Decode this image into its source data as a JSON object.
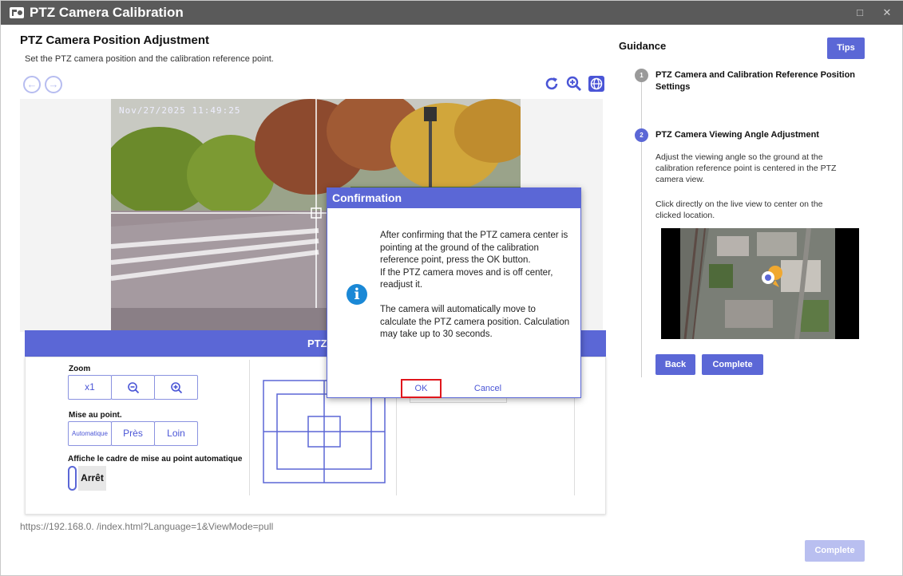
{
  "window": {
    "title": "PTZ Camera Calibration",
    "maximize_glyph": "□",
    "close_glyph": "✕"
  },
  "main": {
    "title": "PTZ Camera Position Adjustment",
    "subtitle": "Set the PTZ camera position and the calibration reference point.",
    "nav": {
      "back_icon": "arrow-left-icon",
      "forward_icon": "arrow-right-icon"
    },
    "tools": [
      "refresh-icon",
      "zoom-search-icon",
      "globe-icon"
    ],
    "camera": {
      "timestamp": "Nov/27/2025 11:49:25"
    }
  },
  "control_panel": {
    "header_label": "PTZ",
    "zoom_label": "Zoom",
    "zoom_buttons": [
      "x1",
      "zoom-out-icon",
      "zoom-in-icon"
    ],
    "zoom_x1": "x1",
    "focus_label": "Mise au point.",
    "focus_auto": "Automatique",
    "focus_near": "Près",
    "focus_far": "Loin",
    "af_frame_label": "Affiche le cadre de mise au point automatique",
    "af_frame_state": "Arrêt"
  },
  "status_url": "https://192.168.0.    /index.html?Language=1&ViewMode=pull",
  "guidance": {
    "title": "Guidance",
    "tips_label": "Tips",
    "steps": [
      {
        "num": "1",
        "title": "PTZ Camera and Calibration Reference Position Settings",
        "color": "#9a9a9a"
      },
      {
        "num": "2",
        "title": "PTZ Camera Viewing Angle Adjustment",
        "color": "#5b67d6"
      }
    ],
    "desc1": "Adjust the viewing angle so the ground at the calibration reference point is centered in the PTZ camera view.",
    "desc2": "Click directly on the live view to center on the clicked location.",
    "back_label": "Back",
    "complete_label": "Complete"
  },
  "footer": {
    "complete_label": "Complete"
  },
  "dialog": {
    "title": "Confirmation",
    "message": "After confirming that the PTZ camera center is pointing at the ground of the calibration reference point, press the OK button.\nIf the PTZ camera moves and is off center, readjust it.\n\nThe camera will automatically move to calculate the PTZ camera position. Calculation may take up to 30 seconds.",
    "ok_label": "OK",
    "cancel_label": "Cancel"
  },
  "colors": {
    "accent": "#5b67d6",
    "titlebar": "#5a5a5a",
    "ok_highlight": "#e0161c",
    "info": "#1a88d6"
  }
}
